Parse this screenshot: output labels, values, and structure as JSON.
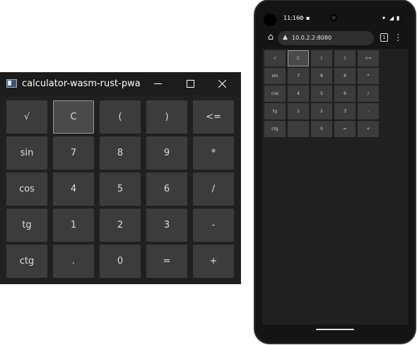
{
  "desktop": {
    "title": "calculator-wasm-rust-pwa",
    "keys": [
      "√",
      "C",
      "(",
      ")",
      "<=",
      "sin",
      "7",
      "8",
      "9",
      "*",
      "cos",
      "4",
      "5",
      "6",
      "/",
      "tg",
      "1",
      "2",
      "3",
      "-",
      "ctg",
      ".",
      "0",
      "=",
      "+"
    ]
  },
  "phone": {
    "status": {
      "time": "11:16",
      "icons": [
        "gear-status-icon",
        "storage-status-icon"
      ],
      "right_icons": [
        "wifi-icon",
        "signal-icon",
        "battery-icon"
      ]
    },
    "browser": {
      "url": "10.0.2.2:8080",
      "tab_count": "1"
    },
    "keys": [
      "√",
      "C",
      "(",
      ")",
      "<=",
      "sin",
      "7",
      "8",
      "9",
      "*",
      "cos",
      "4",
      "5",
      "6",
      "/",
      "tg",
      "1",
      "2",
      "3",
      "-",
      "ctg",
      ".",
      "0",
      "=",
      "+"
    ]
  },
  "colors": {
    "key_bg": "#3c3c3c",
    "window_bg": "#202020",
    "titlebar_bg": "#1c1c1c"
  }
}
